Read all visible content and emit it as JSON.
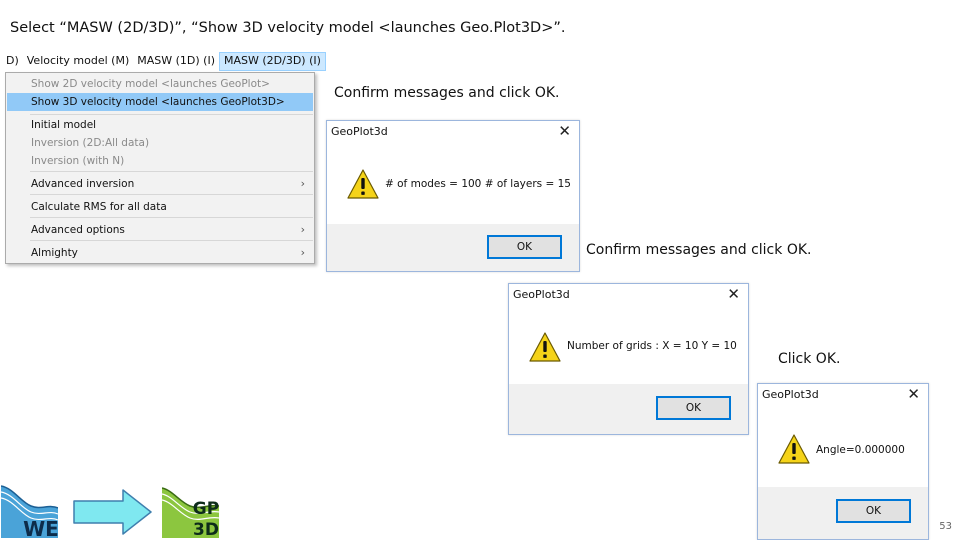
{
  "instructions": {
    "title": "Select “MASW (2D/3D)”, “Show 3D velocity model <launches Geo.Plot3D>”.",
    "step1": "Confirm messages and click OK.",
    "step2": "Confirm messages and click OK.",
    "step3": "Click OK."
  },
  "menubar": {
    "items": [
      "D)",
      "Velocity model (M)",
      "MASW (1D) (I)",
      "MASW (2D/3D) (I)"
    ]
  },
  "menu": {
    "items": [
      {
        "label": "Show 2D velocity model <launches GeoPlot>",
        "state": "disabled"
      },
      {
        "label": "Show 3D velocity model <launches GeoPlot3D>",
        "state": "highlighted"
      },
      {
        "label": "Initial model",
        "state": "enabled"
      },
      {
        "label": "Inversion (2D:All data)",
        "state": "disabled"
      },
      {
        "label": "Inversion (with N)",
        "state": "disabled"
      },
      {
        "label": "Advanced inversion",
        "state": "enabled",
        "submenu": true
      },
      {
        "label": "Calculate RMS for all data",
        "state": "enabled"
      },
      {
        "label": "Advanced options",
        "state": "enabled",
        "submenu": true
      },
      {
        "label": "Almighty",
        "state": "enabled",
        "submenu": true
      }
    ],
    "submenu_glyph": "›"
  },
  "dialogs": [
    {
      "title": "GeoPlot3d",
      "message": "# of modes = 100 # of layers = 15",
      "ok_label": "OK",
      "close_glyph": "✕",
      "icon": "warning-icon"
    },
    {
      "title": "GeoPlot3d",
      "message": "Number of grids : X = 10 Y = 10",
      "ok_label": "OK",
      "close_glyph": "✕",
      "icon": "warning-icon"
    },
    {
      "title": "GeoPlot3d",
      "message": "Angle=0.000000",
      "ok_label": "OK",
      "close_glyph": "✕",
      "icon": "warning-icon"
    }
  ],
  "logos": {
    "source": {
      "text": "WE",
      "icon": "surface-wave-logo"
    },
    "target": {
      "text_top": "GP",
      "text_bottom": "3D",
      "icon": "geoplot3d-logo"
    },
    "arrow": "right-arrow-icon"
  },
  "colors": {
    "highlight": "#91c9f7",
    "menubar_active": "#cce8ff",
    "default_button_border": "#0078d7",
    "arrow_fill": "#7fe8f0",
    "warning_yellow": "#f5d319"
  },
  "page_number": "53"
}
